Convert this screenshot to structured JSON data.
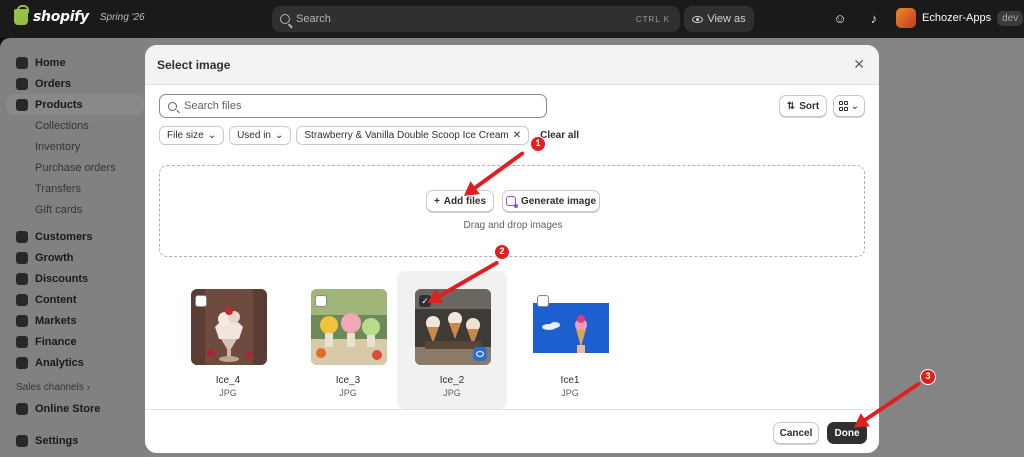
{
  "topbar": {
    "brand": "shopify",
    "edition": "Spring '26",
    "search_placeholder": "Search",
    "search_shortcut": "CTRL  K",
    "view_as": "View as",
    "store_name": "Echozer-Apps",
    "store_badge": "dev"
  },
  "sidebar": {
    "items": [
      {
        "label": "Home"
      },
      {
        "label": "Orders"
      },
      {
        "label": "Products"
      },
      {
        "label": "Collections"
      },
      {
        "label": "Inventory"
      },
      {
        "label": "Purchase orders"
      },
      {
        "label": "Transfers"
      },
      {
        "label": "Gift cards"
      },
      {
        "label": "Customers"
      },
      {
        "label": "Growth"
      },
      {
        "label": "Discounts"
      },
      {
        "label": "Content"
      },
      {
        "label": "Markets"
      },
      {
        "label": "Finance"
      },
      {
        "label": "Analytics"
      }
    ],
    "sales_channels": "Sales channels",
    "online_store": "Online Store",
    "settings": "Settings"
  },
  "modal": {
    "title": "Select image",
    "search_placeholder": "Search files",
    "sort_label": "Sort",
    "filters": {
      "file_size": "File size",
      "used_in": "Used in",
      "product": "Strawberry & Vanilla Double Scoop Ice Cream",
      "clear_all": "Clear all"
    },
    "dropzone": {
      "add_files": "Add files",
      "generate_image": "Generate image",
      "hint": "Drag and drop images"
    },
    "files": [
      {
        "name": "Ice_4",
        "type": "JPG",
        "checked": false
      },
      {
        "name": "Ice_3",
        "type": "JPG",
        "checked": false
      },
      {
        "name": "Ice_2",
        "type": "JPG",
        "checked": true
      },
      {
        "name": "Ice1",
        "type": "JPG",
        "checked": false
      }
    ],
    "cancel": "Cancel",
    "done": "Done"
  },
  "annotations": {
    "step_1": "1",
    "step_2": "2",
    "step_3": "3",
    "color": "#e02020"
  },
  "colors": {
    "topbar": "#1a1a1a",
    "primary_button": "#303030",
    "brand_green": "#95bf47"
  }
}
